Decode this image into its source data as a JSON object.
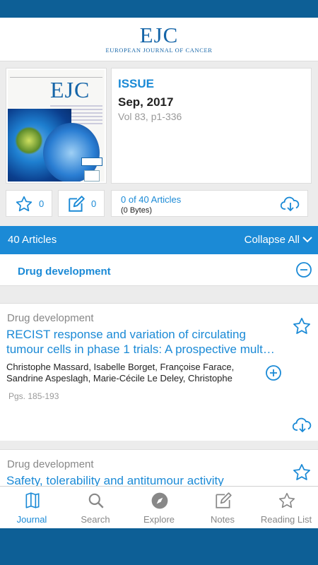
{
  "header": {
    "logo_main": "EJC",
    "logo_sub": "EUROPEAN JOURNAL OF CANCER"
  },
  "cover": {
    "title": "EJC"
  },
  "issue": {
    "label": "ISSUE",
    "date": "Sep, 2017",
    "volume": "Vol 83, p1-336"
  },
  "stats": {
    "favorites_count": "0",
    "notes_count": "0",
    "download_count": "0 of 40 Articles",
    "download_size": "(0 Bytes)"
  },
  "articles_bar": {
    "count_label": "40 Articles",
    "collapse_label": "Collapse All"
  },
  "section": {
    "name": "Drug development"
  },
  "articles": [
    {
      "category": "Drug development",
      "title": "RECIST response and variation of circulating tumour cells in phase 1 trials: A prospective mult…",
      "authors": "Christophe Massard, Isabelle Borget, Françoise Farace, Sandrine Aspeslagh, Marie-Cécile Le Deley, Christophe",
      "pages": "Pgs. 185-193"
    },
    {
      "category": "Drug development",
      "title": "Safety, tolerability and antitumour activity"
    }
  ],
  "tabs": [
    {
      "label": "Journal",
      "icon": "journal-icon"
    },
    {
      "label": "Search",
      "icon": "search-icon"
    },
    {
      "label": "Explore",
      "icon": "compass-icon"
    },
    {
      "label": "Notes",
      "icon": "note-icon"
    },
    {
      "label": "Reading List",
      "icon": "star-icon"
    }
  ],
  "colors": {
    "accent": "#1b8ad6",
    "status_bar": "#0d5f96",
    "brand": "#1565a8"
  }
}
